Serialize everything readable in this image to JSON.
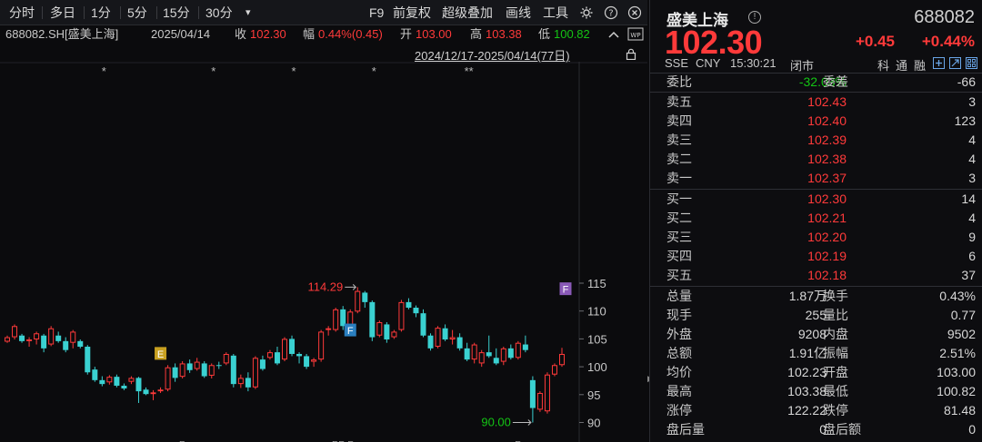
{
  "toolbar": {
    "left_items": [
      "分时",
      "多日",
      "1分",
      "5分",
      "15分",
      "30分"
    ],
    "more_label": "▾",
    "right_items": [
      "F9",
      "前复权",
      "超级叠加",
      "画线",
      "工具"
    ],
    "gear_icon": "gear-icon",
    "help_icon": "question-icon",
    "close_icon": "close-icon"
  },
  "infoline": {
    "code": "688082.SH[盛美上海]",
    "date": "2025/04/14",
    "close_label": "收",
    "close_value": "102.30",
    "range_label": "幅",
    "range_value": "0.44%(0.45)",
    "open_label": "开",
    "open_value": "103.00",
    "high_label": "高",
    "high_value": "103.38",
    "low_label": "低",
    "low_value": "100.82",
    "arrow_icon": "chevron-up-icon",
    "wp_icon": "wp-icon"
  },
  "date_range": "2024/12/17-2025/04/14(77日)",
  "lock_icon": "lock-icon",
  "colors": {
    "up": "#ff3a3a",
    "down": "#14c414",
    "candle_down": "#3ad1d1",
    "candle_up": "#ff3a3a",
    "marker_e": "#c8a020",
    "marker_f_blue": "#2a7fc0",
    "marker_f_purple": "#8a5ab8"
  },
  "chart_data": {
    "type": "candlestick",
    "y_ticks": [
      "115",
      "110",
      "105",
      "100",
      "95",
      "90"
    ],
    "ylim": [
      89,
      116
    ],
    "high_label": "114.29",
    "low_label": "90.00",
    "markers": [
      "E",
      "F",
      "F"
    ],
    "stars": [
      "*",
      "*",
      "*",
      "*",
      "**"
    ],
    "bottom_ticks": [
      "R",
      "RR R",
      "R"
    ],
    "candles": [
      [
        104.5,
        105.6,
        104.3,
        105.3
      ],
      [
        105.3,
        107.6,
        104.9,
        107.3
      ],
      [
        105.6,
        105.9,
        104.3,
        104.6
      ],
      [
        104.6,
        105.3,
        103.6,
        104.9
      ],
      [
        104.9,
        106.3,
        104.0,
        106.0
      ],
      [
        105.6,
        105.9,
        102.6,
        103.3
      ],
      [
        104.0,
        107.3,
        103.7,
        106.9
      ],
      [
        105.6,
        106.3,
        104.3,
        104.6
      ],
      [
        104.6,
        105.3,
        102.6,
        103.0
      ],
      [
        104.3,
        106.6,
        103.3,
        106.3
      ],
      [
        104.6,
        104.9,
        103.3,
        103.6
      ],
      [
        103.6,
        103.9,
        98.6,
        99.0
      ],
      [
        99.5,
        100.0,
        97.3,
        97.6
      ],
      [
        97.6,
        98.3,
        96.5,
        96.9
      ],
      [
        97.2,
        98.5,
        96.8,
        98.2
      ],
      [
        98.2,
        98.6,
        96.3,
        96.6
      ],
      [
        96.6,
        97.0,
        95.8,
        96.1
      ],
      [
        97.3,
        98.3,
        96.9,
        98.0
      ],
      [
        98.0,
        98.2,
        93.5,
        95.6
      ],
      [
        95.9,
        96.3,
        94.9,
        95.1
      ],
      [
        95.1,
        95.8,
        94.0,
        95.4
      ],
      [
        95.6,
        96.3,
        95.3,
        95.9
      ],
      [
        95.9,
        100.3,
        95.6,
        99.9
      ],
      [
        99.9,
        100.6,
        97.3,
        98.0
      ],
      [
        98.2,
        101.0,
        97.9,
        100.6
      ],
      [
        100.6,
        101.3,
        98.9,
        99.4
      ],
      [
        99.6,
        101.6,
        99.3,
        100.9
      ],
      [
        100.6,
        101.0,
        98.0,
        98.3
      ],
      [
        98.4,
        100.6,
        97.9,
        100.3
      ],
      [
        100.3,
        100.9,
        99.6,
        100.2
      ],
      [
        100.6,
        102.6,
        100.3,
        102.3
      ],
      [
        102.0,
        102.3,
        96.3,
        96.9
      ],
      [
        96.9,
        98.6,
        96.2,
        98.0
      ],
      [
        98.0,
        99.0,
        95.6,
        96.3
      ],
      [
        96.3,
        101.9,
        96.0,
        101.6
      ],
      [
        101.3,
        102.0,
        99.3,
        99.6
      ],
      [
        101.6,
        103.0,
        101.3,
        102.6
      ],
      [
        102.6,
        103.6,
        100.3,
        100.6
      ],
      [
        101.3,
        105.3,
        101.0,
        105.0
      ],
      [
        105.0,
        105.6,
        101.9,
        102.3
      ],
      [
        102.3,
        102.6,
        100.6,
        101.9
      ],
      [
        101.9,
        102.3,
        99.6,
        100.0
      ],
      [
        100.9,
        101.6,
        100.0,
        101.3
      ],
      [
        101.3,
        106.6,
        100.9,
        106.3
      ],
      [
        106.6,
        107.3,
        105.6,
        106.9
      ],
      [
        106.6,
        110.6,
        106.3,
        110.3
      ],
      [
        110.3,
        110.9,
        106.6,
        107.3
      ],
      [
        107.0,
        110.3,
        106.3,
        109.9
      ],
      [
        109.9,
        114.29,
        109.6,
        113.6
      ],
      [
        113.3,
        113.6,
        110.6,
        111.6
      ],
      [
        111.6,
        111.9,
        104.6,
        105.3
      ],
      [
        105.6,
        108.3,
        105.3,
        108.0
      ],
      [
        107.6,
        108.0,
        104.3,
        104.9
      ],
      [
        105.3,
        106.6,
        105.0,
        106.3
      ],
      [
        106.6,
        112.0,
        106.3,
        111.6
      ],
      [
        111.6,
        112.3,
        110.3,
        110.6
      ],
      [
        110.6,
        111.0,
        108.9,
        109.6
      ],
      [
        109.6,
        110.3,
        105.3,
        105.6
      ],
      [
        105.6,
        106.0,
        102.9,
        103.3
      ],
      [
        103.6,
        107.3,
        103.3,
        107.0
      ],
      [
        106.9,
        107.6,
        104.6,
        104.9
      ],
      [
        104.9,
        106.6,
        104.0,
        105.3
      ],
      [
        105.3,
        106.0,
        102.9,
        103.3
      ],
      [
        103.3,
        104.3,
        101.0,
        101.3
      ],
      [
        101.3,
        104.3,
        100.6,
        104.0
      ],
      [
        100.6,
        103.0,
        100.0,
        102.6
      ],
      [
        102.6,
        105.6,
        101.6,
        101.9
      ],
      [
        101.6,
        103.3,
        100.3,
        100.6
      ],
      [
        100.9,
        103.6,
        100.3,
        103.3
      ],
      [
        103.3,
        104.0,
        101.3,
        101.6
      ],
      [
        101.6,
        104.6,
        101.3,
        104.3
      ],
      [
        104.0,
        105.6,
        102.6,
        103.0
      ],
      [
        97.6,
        98.3,
        90.0,
        92.6
      ],
      [
        92.3,
        95.6,
        91.9,
        95.3
      ],
      [
        92.0,
        99.0,
        91.6,
        98.6
      ],
      [
        98.6,
        100.6,
        98.3,
        100.3
      ],
      [
        100.3,
        103.4,
        100.0,
        102.3
      ]
    ]
  },
  "panel": {
    "name": "盛美上海",
    "info_icon": "info-icon",
    "code": "688082",
    "last_price": "102.30",
    "change": "+0.45",
    "change_pct": "+0.44%",
    "status": {
      "exchange": "SSE",
      "currency": "CNY",
      "time": "15:30:21",
      "state": "闭市"
    },
    "tags": [
      "科",
      "通",
      "融"
    ],
    "bid_ratio_label": "委比",
    "bid_ratio_value": "-32.03%",
    "bid_diff_label": "委差",
    "bid_diff_value": "-66",
    "asks": [
      {
        "label": "卖五",
        "price": "102.43",
        "vol": "3"
      },
      {
        "label": "卖四",
        "price": "102.40",
        "vol": "123"
      },
      {
        "label": "卖三",
        "price": "102.39",
        "vol": "4"
      },
      {
        "label": "卖二",
        "price": "102.38",
        "vol": "4"
      },
      {
        "label": "卖一",
        "price": "102.37",
        "vol": "3"
      }
    ],
    "bids": [
      {
        "label": "买一",
        "price": "102.30",
        "vol": "14"
      },
      {
        "label": "买二",
        "price": "102.21",
        "vol": "4"
      },
      {
        "label": "买三",
        "price": "102.20",
        "vol": "9"
      },
      {
        "label": "买四",
        "price": "102.19",
        "vol": "6"
      },
      {
        "label": "买五",
        "price": "102.18",
        "vol": "37"
      }
    ],
    "stats": [
      {
        "l1": "总量",
        "v1": "1.87万",
        "c1": "",
        "l2": "换手",
        "v2": "0.43%",
        "c2": ""
      },
      {
        "l1": "现手",
        "v1": "255",
        "c1": "",
        "l2": "量比",
        "v2": "0.77",
        "c2": ""
      },
      {
        "l1": "外盘",
        "v1": "9208",
        "c1": "red",
        "l2": "内盘",
        "v2": "9502",
        "c2": "green"
      },
      {
        "l1": "总额",
        "v1": "1.91亿",
        "c1": "",
        "l2": "振幅",
        "v2": "2.51%",
        "c2": ""
      },
      {
        "l1": "均价",
        "v1": "102.23",
        "c1": "red",
        "l2": "开盘",
        "v2": "103.00",
        "c2": "red"
      },
      {
        "l1": "最高",
        "v1": "103.38",
        "c1": "red",
        "l2": "最低",
        "v2": "100.82",
        "c2": "green"
      },
      {
        "l1": "涨停",
        "v1": "122.22",
        "c1": "red",
        "l2": "跌停",
        "v2": "81.48",
        "c2": "green"
      },
      {
        "l1": "盘后量",
        "v1": "0",
        "c1": "",
        "l2": "盘后额",
        "v2": "0",
        "c2": ""
      }
    ]
  }
}
